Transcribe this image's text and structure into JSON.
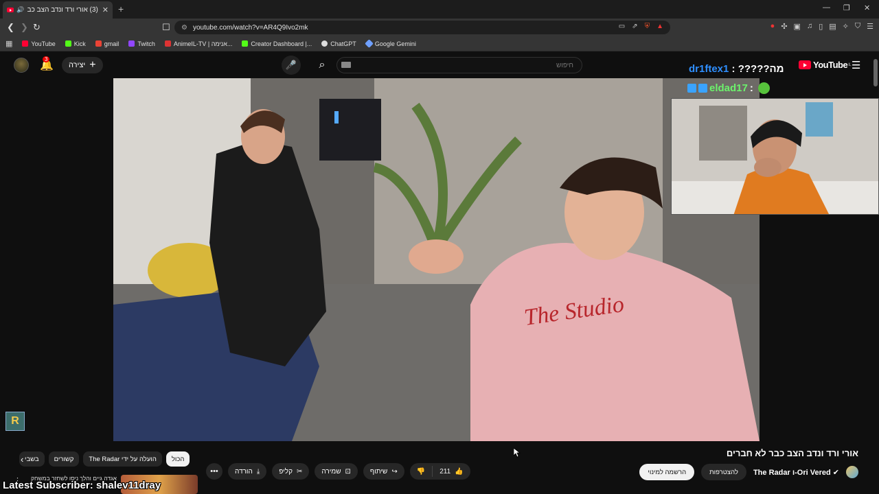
{
  "browser": {
    "tab": {
      "title": "(3) אורי ורד ונדב הצב כבר לא ",
      "close": "✕"
    },
    "new_tab": "+",
    "window_controls": [
      "—",
      "❐",
      "✕"
    ],
    "url": "youtube.com/watch?v=AR4Q9Ivo2mk",
    "bookmarks": [
      {
        "label": "YouTube",
        "color": "#ff0033"
      },
      {
        "label": "Kick",
        "color": "#53fc18"
      },
      {
        "label": "gmail",
        "color": "#ea4335"
      },
      {
        "label": "Twitch",
        "color": "#9146ff"
      },
      {
        "label": "AnimeIL-TV | אנימה...",
        "color": "#d33"
      },
      {
        "label": "Creator Dashboard |...",
        "color": "#53fc18"
      },
      {
        "label": "ChatGPT",
        "color": "#dddddd"
      },
      {
        "label": "Google Gemini",
        "color": "#6fa0ff"
      }
    ]
  },
  "youtube": {
    "create_label": "יצירה",
    "notification_count": "3",
    "search_placeholder": "חיפוש",
    "logo_text": "YouTube",
    "logo_region": "IL"
  },
  "stream_overlay": {
    "chat": [
      {
        "user": "dr1ftex1",
        "message": "?????מה"
      },
      {
        "user": "eldad17"
      }
    ],
    "latest_subscriber": "Latest Subscriber: shalev11dray",
    "logo_letter": "R"
  },
  "video": {
    "title": "אורי ורד ונדב הצב כבר לא חברים",
    "channel_name": "The Radar ו-Ori Vered",
    "join_label": "להצטרפות",
    "subscribe_label": "הרשמה למינוי",
    "like_count": "211",
    "share_label": "שיתוף",
    "save_label": "שמירה",
    "clip_label": "קליפ",
    "download_label": "הורדה"
  },
  "related_chips": [
    {
      "label": "הכול",
      "active": true
    },
    {
      "label": "הועלה על ידי The Radar",
      "active": false
    },
    {
      "label": "קשורים",
      "active": false
    },
    {
      "label": "בשבי",
      "active": false
    }
  ],
  "related_video": {
    "title": "אגדה גיים והלך ניסו לשחזר במשחק"
  }
}
